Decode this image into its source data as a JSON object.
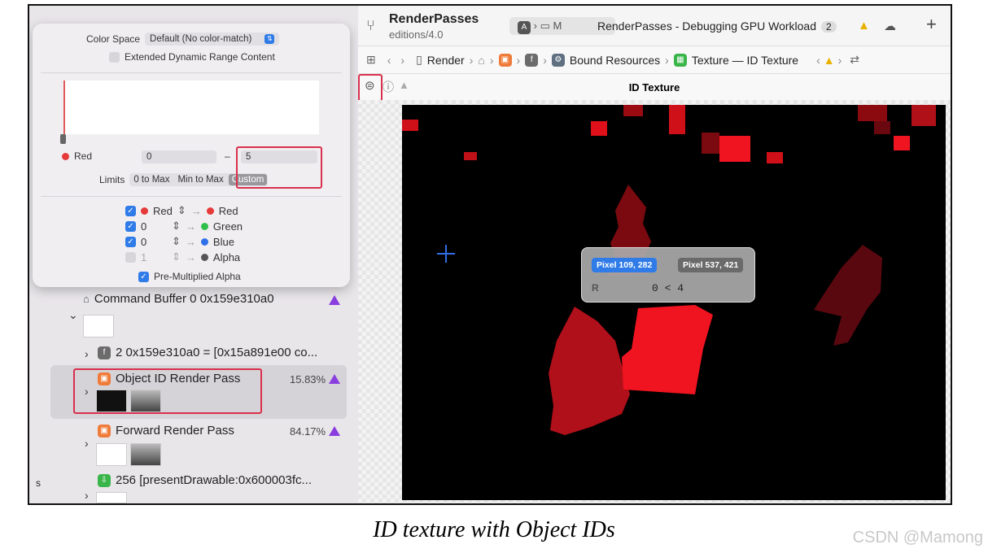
{
  "popover": {
    "color_space_label": "Color Space",
    "color_space_value": "Default (No color-match)",
    "extended_dr_label": "Extended Dynamic Range Content",
    "channel_label": "Red",
    "range_min": "0",
    "range_sep": "–",
    "range_max": "5",
    "limits_label": "Limits",
    "limit_options": [
      "0 to Max",
      "Min to Max",
      "Custom"
    ],
    "mapping": [
      {
        "source": "Red",
        "target": "Red",
        "checked": true
      },
      {
        "source": "0",
        "target": "Green",
        "checked": true
      },
      {
        "source": "0",
        "target": "Blue",
        "checked": true
      },
      {
        "source": "1",
        "target": "Alpha",
        "checked": false
      }
    ],
    "premultiplied_label": "Pre-Multiplied Alpha"
  },
  "navigator": {
    "command_buffer": "Command Buffer 0 0x159e310a0",
    "encoder_row": "2 0x159e310a0 = [0x15a891e00 co...",
    "passes": [
      {
        "label": "Object ID Render Pass",
        "percent": "15.83%"
      },
      {
        "label": "Forward Render Pass",
        "percent": "84.17%"
      }
    ],
    "present_row": "256 [presentDrawable:0x600003fc...",
    "edge_letter": "s"
  },
  "toolbar": {
    "project_name": "RenderPasses",
    "branch": "editions/4.0",
    "scheme_letter": "M",
    "tab_title": "RenderPasses - Debugging GPU Workload",
    "tab_count": "2",
    "plus": "+"
  },
  "jumpbar": {
    "item_render": "Render",
    "item_bound": "Bound Resources",
    "item_texture": "Texture — ID Texture"
  },
  "editor_header": {
    "title": "ID Texture"
  },
  "inspector": {
    "pixel_a": "Pixel 109, 282",
    "pixel_b": "Pixel 537, 421",
    "channel": "R",
    "comparison": "0 < 4"
  },
  "caption": "ID texture with Object IDs",
  "watermark": "CSDN @Mamong",
  "colors": {
    "accent": "#2f7be8",
    "highlight": "#d9304d",
    "warning_purple": "#8a3ee0",
    "id_red": "#e0101a"
  }
}
